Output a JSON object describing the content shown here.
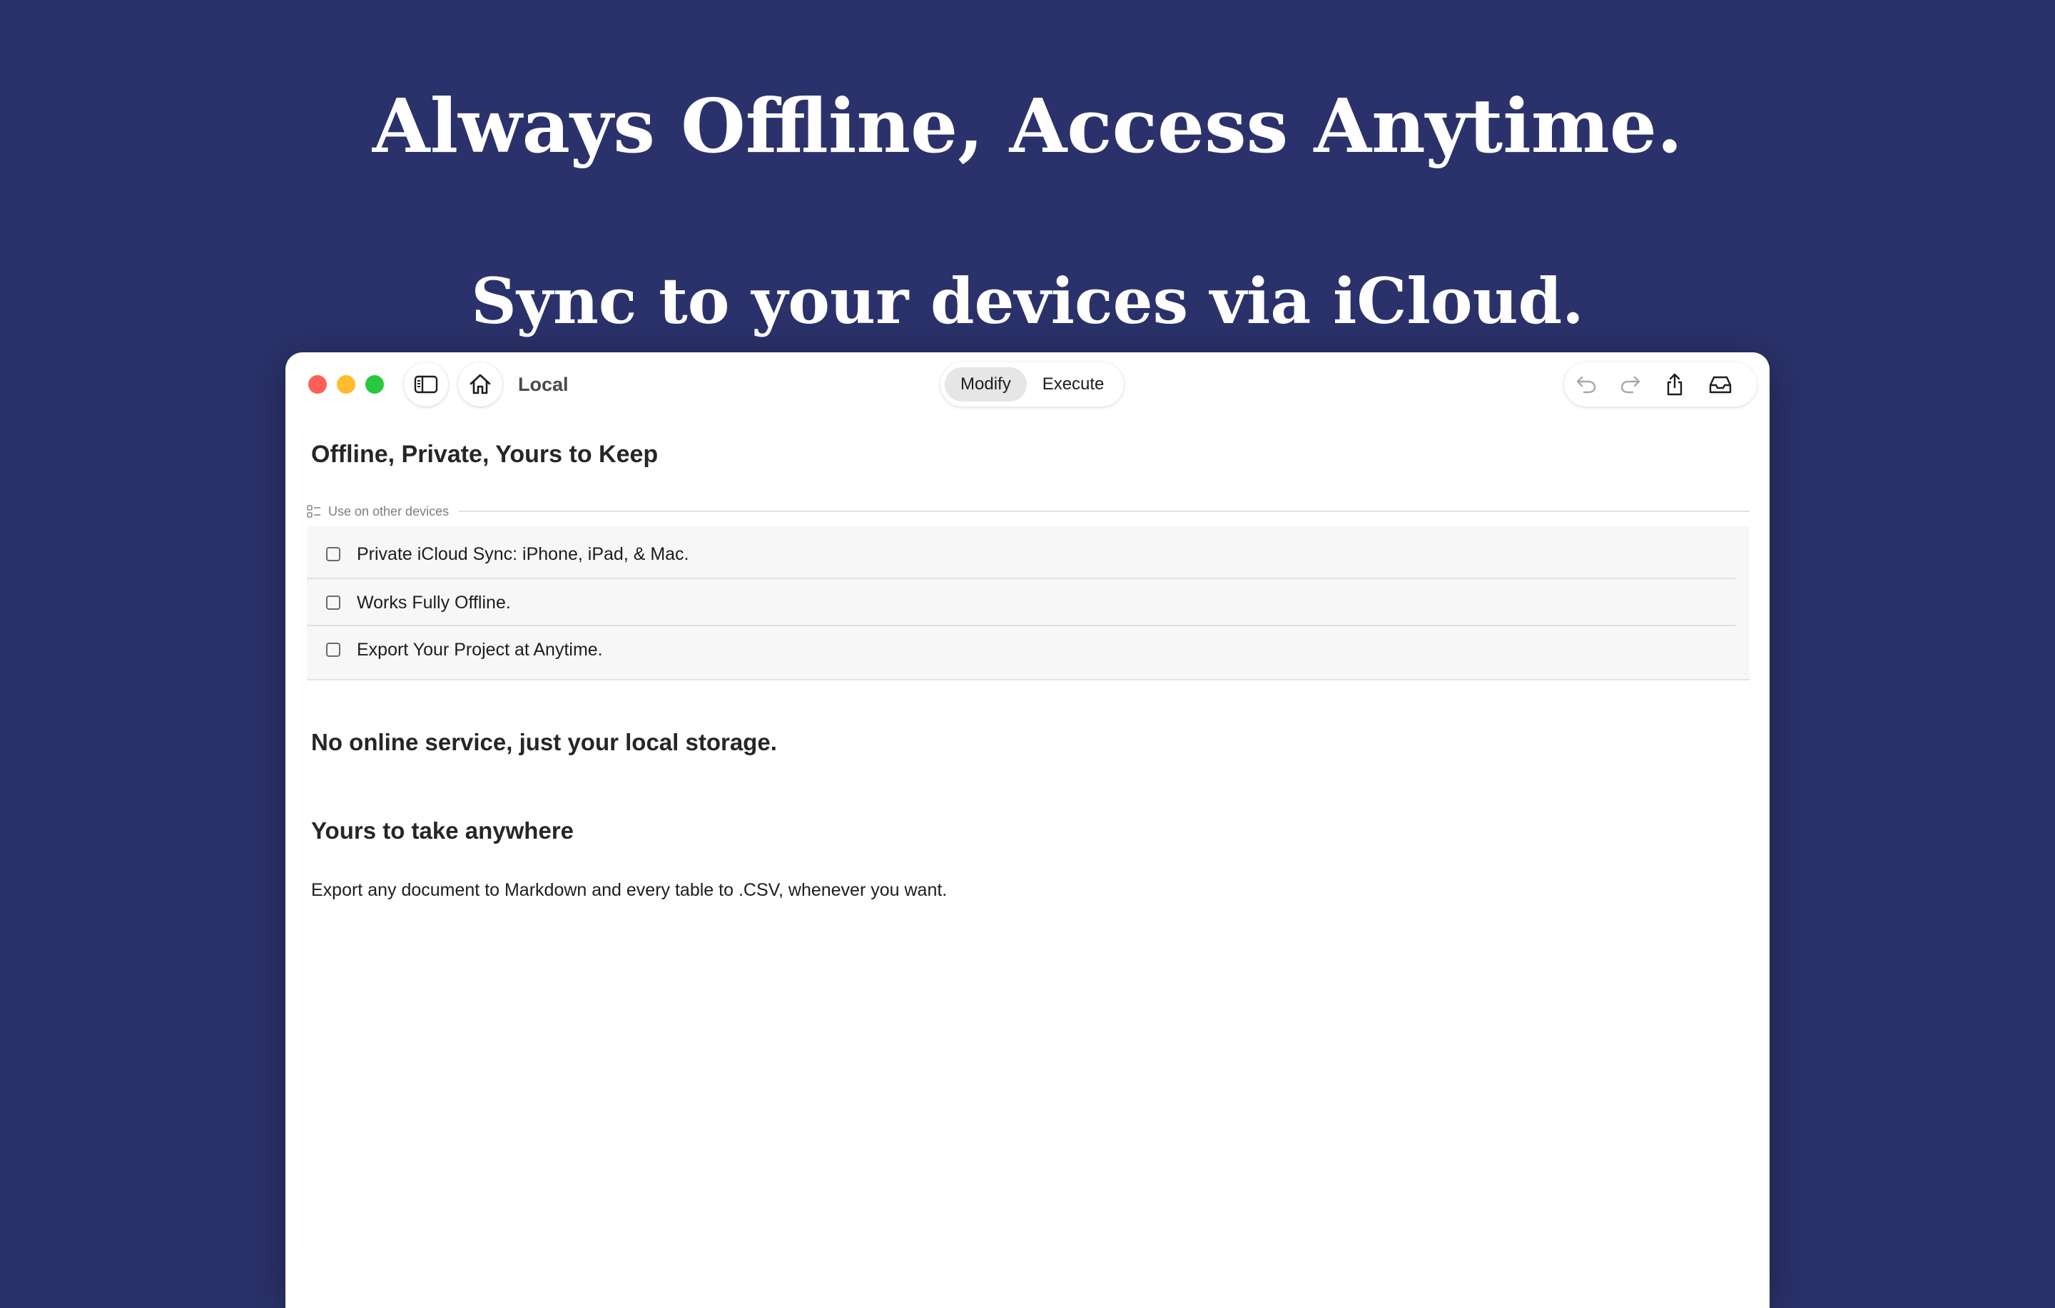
{
  "hero": {
    "headline": "Always Offline, Access Anytime.",
    "subheadline": "Sync to your devices via iCloud."
  },
  "window": {
    "title": "Local",
    "traffic_lights": {
      "close": "#ff5f57",
      "minimize": "#febc2e",
      "zoom": "#28c840"
    },
    "mode_tabs": [
      {
        "label": "Modify",
        "selected": true
      },
      {
        "label": "Execute",
        "selected": false
      }
    ],
    "toolbar_icons": [
      "undo-icon",
      "redo-icon",
      "share-icon",
      "inbox-icon"
    ]
  },
  "document": {
    "heading": "Offline, Private, Yours to Keep",
    "checklist": {
      "label": "Use on other devices",
      "items": [
        {
          "text": "Private iCloud Sync: iPhone, iPad, & Mac.",
          "checked": false
        },
        {
          "text": "Works Fully Offline.",
          "checked": false
        },
        {
          "text": "Export Your Project at Anytime.",
          "checked": false
        }
      ]
    },
    "heading2": "No online service, just your local storage.",
    "heading3": "Yours to take anywhere",
    "paragraph": "Export any document to Markdown and every table to .CSV, whenever you want."
  },
  "colors": {
    "background": "#2b326b",
    "window": "#ffffff",
    "checklist_bg": "#f7f7f7"
  }
}
